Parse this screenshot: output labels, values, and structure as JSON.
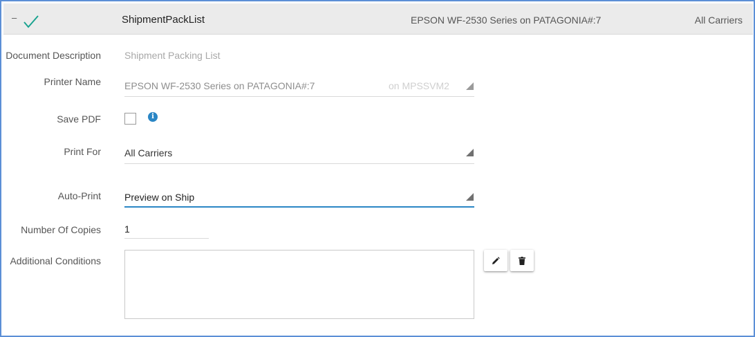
{
  "header": {
    "collapse_symbol": "–",
    "status_icon": "check-icon",
    "title": "ShipmentPackList",
    "printer": "EPSON WF-2530 Series on PATAGONIA#:7",
    "carriers": "All Carriers"
  },
  "form": {
    "document_description": {
      "label": "Document Description",
      "value": "Shipment Packing List"
    },
    "printer_name": {
      "label": "Printer Name",
      "value": "EPSON WF-2530 Series on PATAGONIA#:7",
      "suffix": "on MPSSVM2"
    },
    "save_pdf": {
      "label": "Save PDF",
      "checked": false,
      "info_glyph": "i"
    },
    "print_for": {
      "label": "Print For",
      "value": "All Carriers"
    },
    "auto_print": {
      "label": "Auto-Print",
      "value": "Preview on Ship"
    },
    "number_of_copies": {
      "label": "Number Of Copies",
      "value": "1"
    },
    "additional_conditions": {
      "label": "Additional Conditions",
      "value": ""
    }
  },
  "actions": {
    "edit_icon": "pencil-icon",
    "delete_icon": "trash-icon"
  },
  "colors": {
    "accent": "#2a86c5",
    "check": "#1aa390",
    "frame": "#5b8fd6",
    "header_bg": "#ebebeb"
  }
}
